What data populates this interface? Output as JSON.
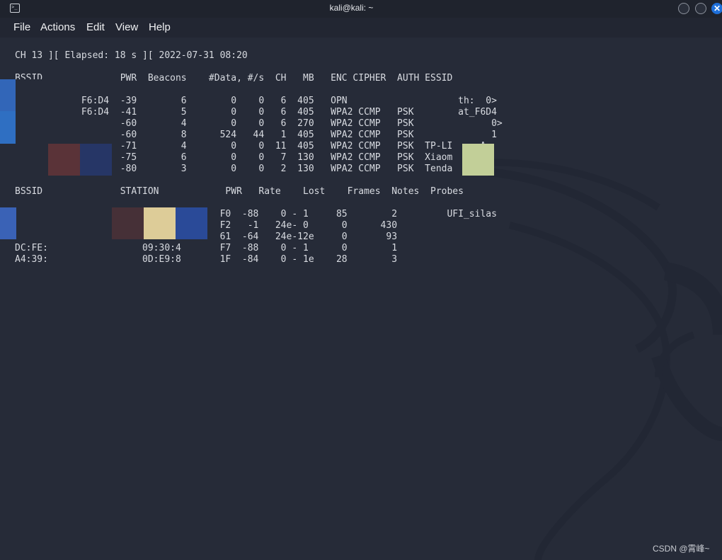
{
  "window": {
    "title": "kali@kali: ~",
    "close_glyph": "✕"
  },
  "menu": [
    "File",
    "Actions",
    "Edit",
    "View",
    "Help"
  ],
  "terminal": {
    "status_line": "CH 13 ][ Elapsed: 18 s ][ 2022-07-31 08:20",
    "ap_header": "BSSID              PWR  Beacons    #Data, #/s  CH   MB   ENC CIPHER  AUTH ESSID",
    "ap_rows": [
      "           :F6:D4  -39        6        0    0   6  405   OPN                    th:  0>",
      "           :F6:D4  -41        5        0    0   6  405   WPA2 CCMP   PSK        at_F6D4",
      "                   -60        4        0    0   6  270   WPA2 CCMP   PSK              0>",
      "                   -60        8      524   44   1  405   WPA2 CCMP   PSK              1",
      "                   -71        4        0    0  11  405   WPA2 CCMP   PSK  TP-LI     A",
      "                   -75        6        0    0   7  130   WPA2 CCMP   PSK  Xiaom     6",
      "                   -80        3        0    0   2  130   WPA2 CCMP   PSK  Tenda     8"
    ],
    "sta_header": "BSSID              STATION            PWR   Rate    Lost    Frames  Notes  Probes",
    "sta_rows": [
      "                                     F0  -88    0 - 1     85        2         UFI_silas",
      "                                     F2   -1   24e- 0      0      430",
      "43:02:                 2:97:         61  -64   24e-12e     0       93",
      "DC:FE:                 09:30:4       F7  -88    0 - 1      0        1",
      "A4:39:                 0D:E9:8       1F  -84    0 - 1e    28        3"
    ]
  },
  "watermark": "CSDN @霄峰~",
  "colors": {
    "background": "#262b38",
    "titlebar": "#1f232d",
    "menubar": "#222632",
    "text": "#d8dbe1",
    "accent": "#1e6fd9"
  }
}
